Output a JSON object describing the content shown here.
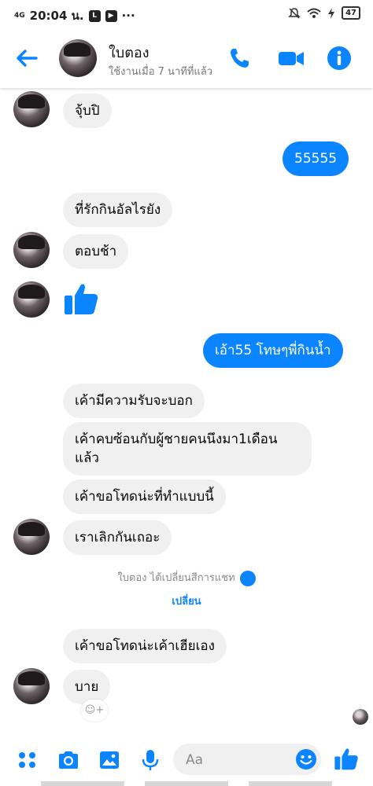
{
  "status_bar": {
    "network": "4G",
    "time": "20:04 น.",
    "more": "···",
    "battery": "47"
  },
  "header": {
    "contact_name": "ใบตอง",
    "contact_status": "ใช้งานเมื่อ 7 นาทีที่แล้ว"
  },
  "messages": [
    {
      "from": "them",
      "text": "จุ้บปิ"
    },
    {
      "from": "me",
      "text": "55555"
    },
    {
      "from": "them",
      "text": "ที่รักกินอัลไรยัง"
    },
    {
      "from": "them",
      "text": "ตอบช้า"
    },
    {
      "from": "them",
      "type": "like"
    },
    {
      "from": "me",
      "text": "เอ้า55 โทษๆพี่กินน้ำ"
    },
    {
      "from": "them",
      "text": "เค้ามีความรับจะบอก"
    },
    {
      "from": "them",
      "text": "เค้าคบซ้อนกับผู้ชายคนนึงมา1เดือนแล้ว"
    },
    {
      "from": "them",
      "text": "เค้าขอโทดน่ะที่ทำแบบนี้"
    },
    {
      "from": "them",
      "text": "เราเลิกกันเถอะ"
    },
    {
      "from": "them",
      "text": "เค้าขอโทดน่ะเค้าเฮียเอง"
    },
    {
      "from": "them",
      "text": "บาย"
    }
  ],
  "system_notice": {
    "text": "ใบตอง ได้เปลี่ยนสีการแชท",
    "link": "เปลี่ยน"
  },
  "composer": {
    "placeholder": "Aa"
  },
  "colors": {
    "accent": "#0a84ff",
    "bubble_in": "#f0f0f0",
    "bubble_out": "#0a84ff"
  }
}
